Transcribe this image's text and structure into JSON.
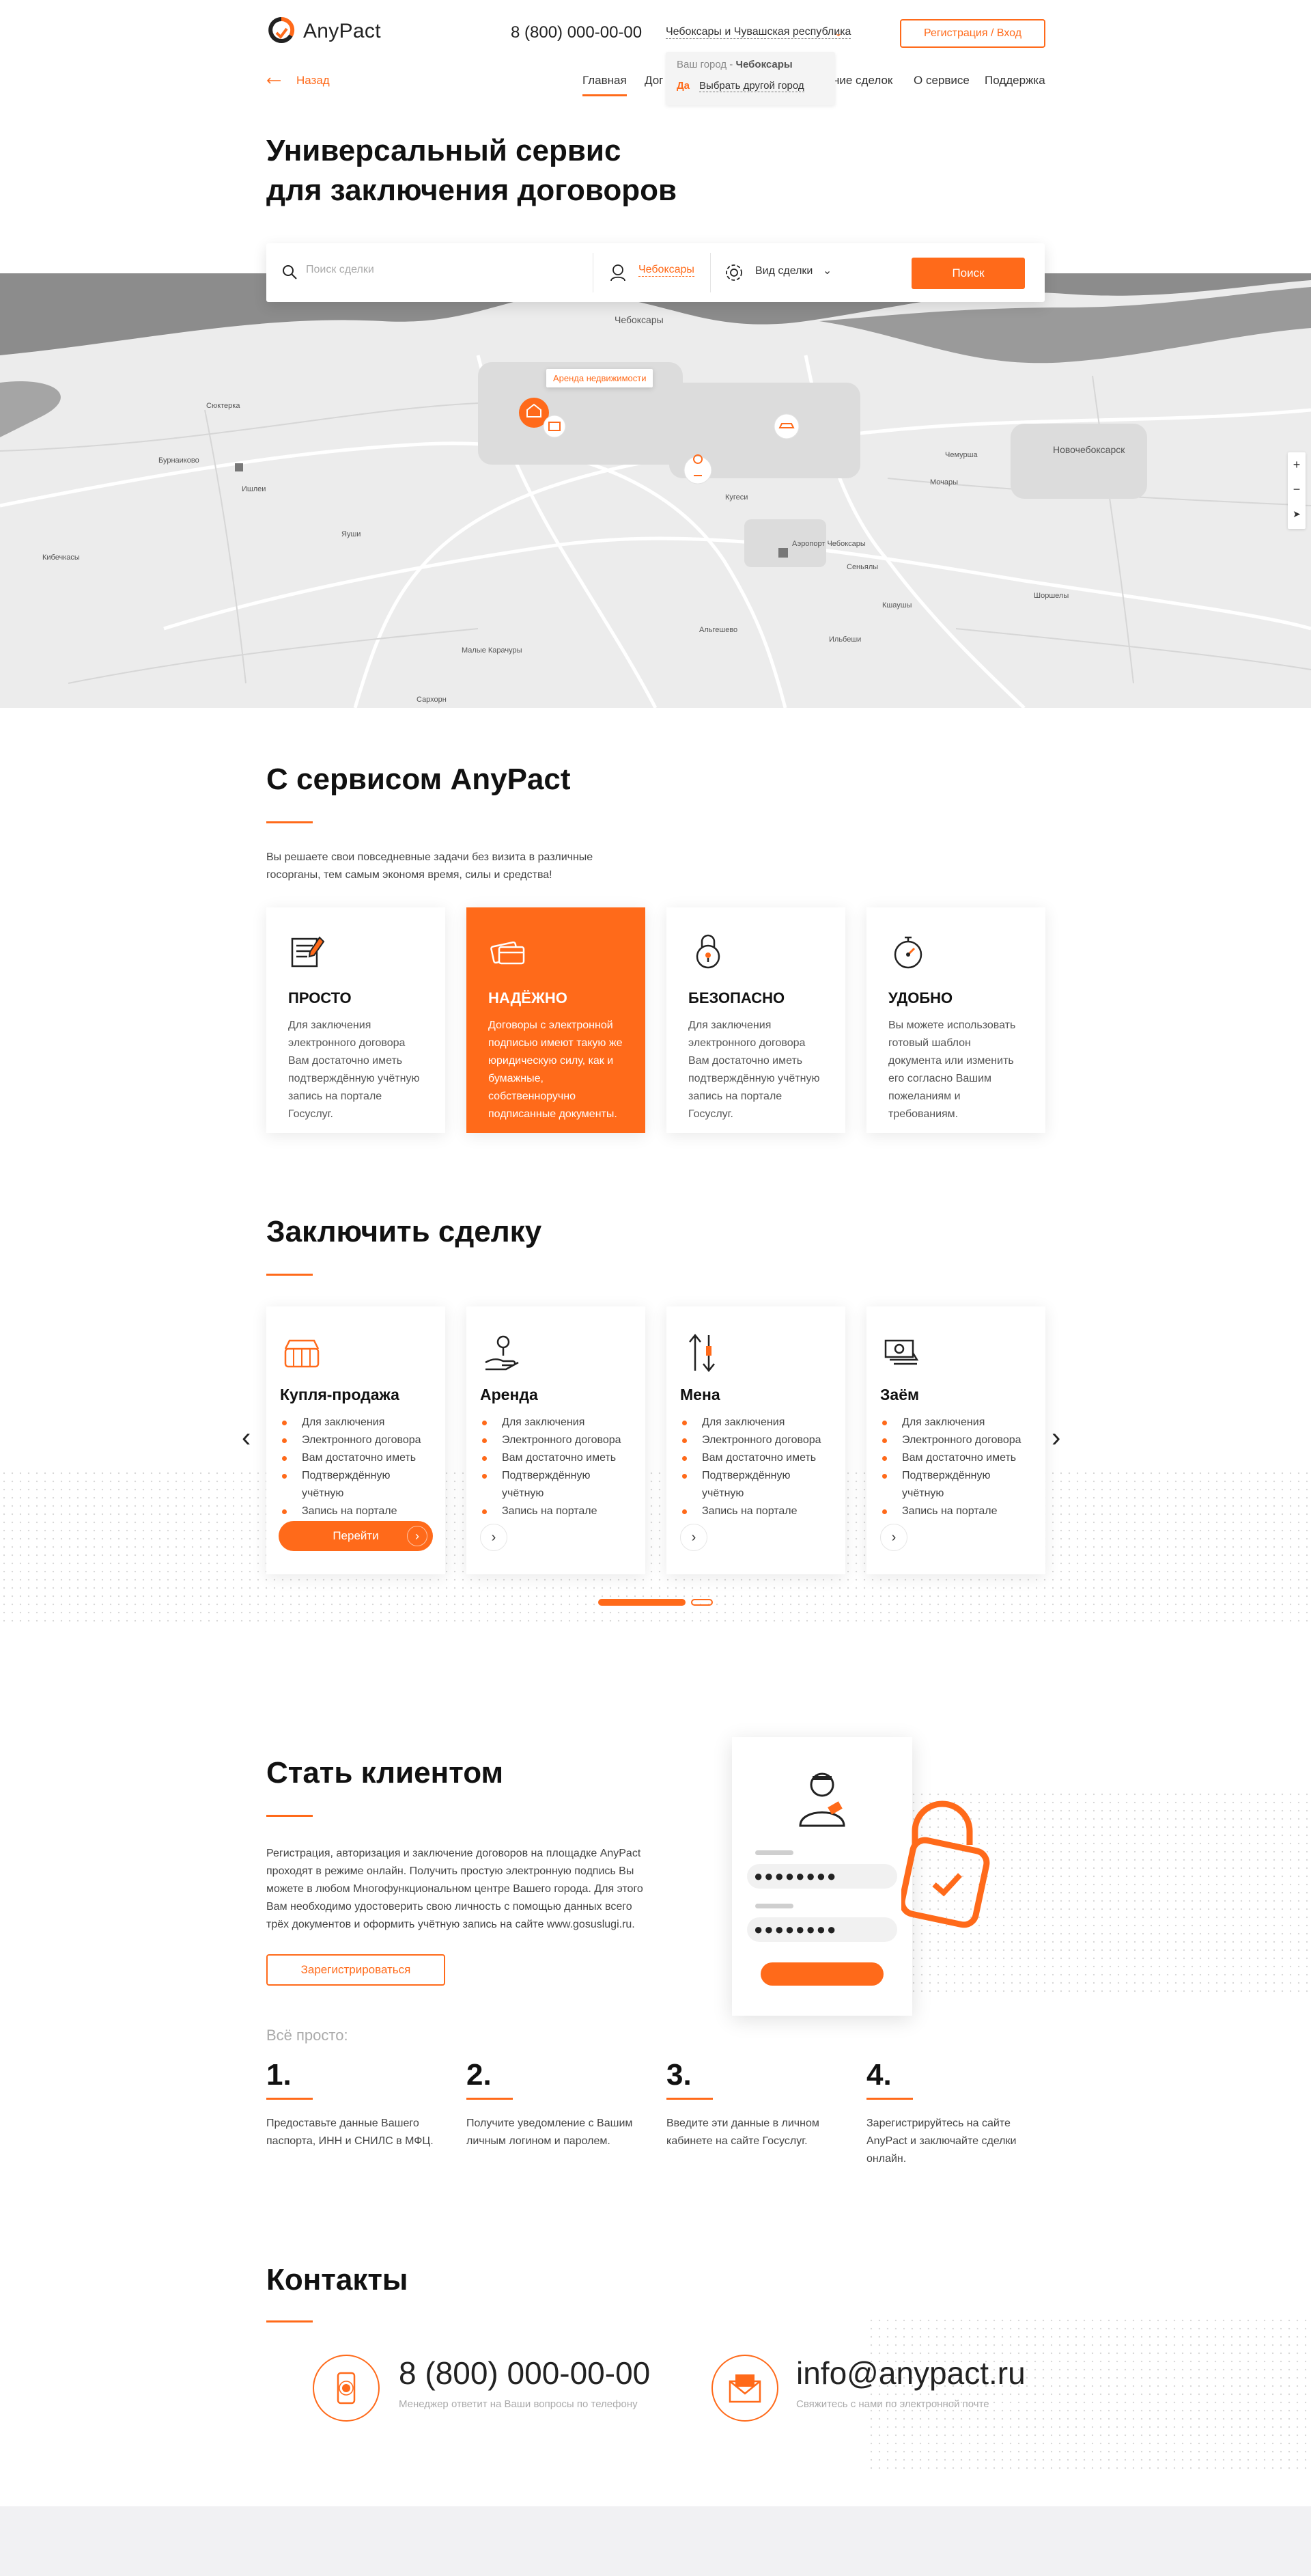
{
  "header": {
    "logo_text": "AnyPact",
    "phone": "8 (800) 000-00-00",
    "region": "Чебоксары и Чувашская республика",
    "login_label": "Регистрация / Вход",
    "back_label": "Назад",
    "nav": [
      {
        "label": "Главная"
      },
      {
        "label": "Дог"
      },
      {
        "label": "ние сделок"
      },
      {
        "label": "О сервисе"
      },
      {
        "label": "Поддержка"
      }
    ],
    "city_popup": {
      "question_prefix": "Ваш город -",
      "city": "Чебоксары",
      "yes": "Да",
      "other": "Выбрать другой город"
    }
  },
  "hero": {
    "title_line1": "Универсальный сервис",
    "title_line2": "для заключения договоров"
  },
  "search": {
    "placeholder": "Поиск сделки",
    "city": "Чебоксары",
    "type_label": "Вид сделки",
    "button": "Поиск"
  },
  "map": {
    "tooltip": "Аренда недвижимости",
    "labels": [
      "Чебоксары",
      "Новочебоксарск",
      "Кугеси",
      "Аэропорт Чебоксары",
      "Альгешево",
      "Сюктерка",
      "Бурнаиково",
      "Ишлеи",
      "Ильбеши",
      "Чемурша",
      "Сеньялы",
      "Кшаушы",
      "Яуши",
      "Кибечкасы",
      "Малые Карачуры",
      "Сархорн",
      "Шоршелы",
      "Мочары"
    ],
    "zoom_in": "+",
    "zoom_out": "−"
  },
  "features": {
    "title": "С сервисом AnyPact",
    "lead": "Вы решаете свои повседневные задачи без визита в различные госорганы, тем самым экономя время, силы и средства!",
    "cards": [
      {
        "title": "ПРОСТО",
        "text": "Для заключения электронного договора Вам достаточно иметь подтверждённую учётную запись на портале Госуслуг.",
        "icon": "document-pen-icon"
      },
      {
        "title": "НАДЁЖНО",
        "text": "Договоры с электронной подписью имеют такую же юридическую силу, как и бумажные, собственноручно подписанные документы.",
        "icon": "cards-icon"
      },
      {
        "title": "БЕЗОПАСНО",
        "text": "Для заключения электронного договора Вам достаточно иметь подтверждённую учётную запись на портале Госуслуг.",
        "icon": "padlock-icon"
      },
      {
        "title": "УДОБНО",
        "text": "Вы можете использовать готовый шаблон документа или изменить его согласно Вашим пожеланиям и требованиям.",
        "icon": "stopwatch-icon"
      }
    ]
  },
  "deals": {
    "title": "Заключить сделку",
    "go_label": "Перейти",
    "cards": [
      {
        "title": "Купля-продажа",
        "icon": "cart-icon",
        "items": [
          "Для заключения",
          "Электронного договора",
          "Вам достаточно иметь",
          "Подтверждённую учётную",
          "Запись на портале"
        ]
      },
      {
        "title": "Аренда",
        "icon": "hand-key-icon",
        "items": [
          "Для заключения",
          "Электронного договора",
          "Вам достаточно иметь",
          "Подтверждённую учётную",
          "Запись на портале"
        ]
      },
      {
        "title": "Мена",
        "icon": "exchange-arrows-icon",
        "items": [
          "Для заключения",
          "Электронного договора",
          "Вам достаточно иметь",
          "Подтверждённую учётную",
          "Запись на портале"
        ]
      },
      {
        "title": "Заём",
        "icon": "money-icon",
        "items": [
          "Для заключения",
          "Электронного договора",
          "Вам достаточно иметь",
          "Подтверждённую учётную",
          "Запись на портале"
        ]
      }
    ]
  },
  "client": {
    "title": "Стать клиентом",
    "text": "Регистрация, авторизация и заключение договоров на площадке AnyPact проходят в режиме онлайн. Получить простую электронную подпись Вы можете в любом Многофункциональном центре Вашего города. Для этого Вам необходимо удостоверить свою личность с помощью данных всего трёх документов и оформить учётную запись на сайте www.gosuslugi.ru.",
    "register_label": "Зарегистрироваться",
    "simple_label": "Всё просто:",
    "password_mask": "●●●●●●●●",
    "steps": [
      {
        "num": "1.",
        "text": "Предоставьте данные Вашего паспорта, ИНН и СНИЛС в МФЦ."
      },
      {
        "num": "2.",
        "text": "Получите уведомление с Вашим личным логином и паролем."
      },
      {
        "num": "3.",
        "text": "Введите эти данные в личном кабинете на сайте Госуслуг."
      },
      {
        "num": "4.",
        "text": "Зарегистрируйтесь на сайте AnyPact и заключайте сделки онлайн."
      }
    ]
  },
  "contacts": {
    "title": "Контакты",
    "phone": "8 (800) 000-00-00",
    "phone_note": "Менеджер ответит на Ваши вопросы по телефону",
    "email": "info@anypact.ru",
    "email_note": "Свяжитесь с нами по электронной почте"
  },
  "colors": {
    "accent": "#ff6a1a",
    "text": "#1a1a1a",
    "footer": "#f1f1f3"
  }
}
